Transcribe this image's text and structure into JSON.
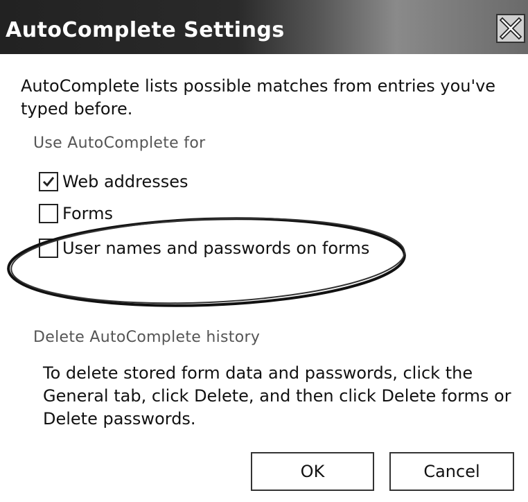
{
  "window": {
    "title": "AutoComplete Settings"
  },
  "intro": {
    "text": "AutoComplete lists possible matches from entries you've typed before."
  },
  "use_group": {
    "label": "Use AutoComplete for",
    "options": [
      {
        "label": "Web addresses",
        "checked": true
      },
      {
        "label": "Forms",
        "checked": false
      },
      {
        "label": "User names and passwords on forms",
        "checked": false
      }
    ]
  },
  "delete_group": {
    "label": "Delete AutoComplete history",
    "text": "To delete stored form data and passwords, click the General tab, click Delete, and then click Delete forms or Delete passwords."
  },
  "buttons": {
    "ok": "OK",
    "cancel": "Cancel"
  },
  "icons": {
    "close": "close-icon",
    "check": "check-icon"
  }
}
